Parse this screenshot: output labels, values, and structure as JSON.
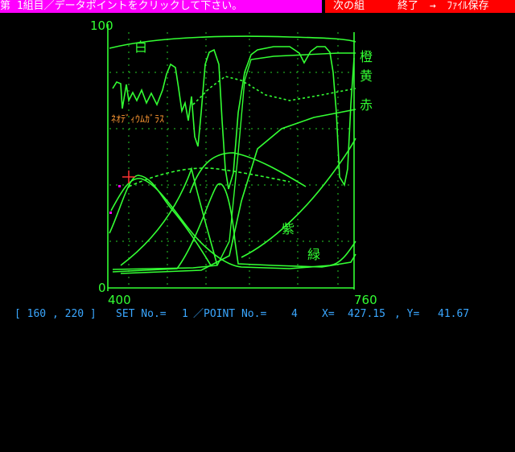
{
  "top_bar": {
    "instruction": "第 1組目／データポイントをクリックして下さい。",
    "next_set": "次の組",
    "end": "終了",
    "arrow": "→",
    "save_file": "ﾌｧｲﾙ保存"
  },
  "plot": {
    "y_top_label": "100",
    "y_bottom_label": "0",
    "x_left_label": "400",
    "x_right_label": "760",
    "labels": {
      "white": "白",
      "orange": "橙",
      "yellow": "黄",
      "red": "赤",
      "purple": "紫",
      "green": "緑",
      "neodymium": "ﾈｵﾃﾞｨｳﾑｶﾞﾗｽ"
    },
    "colors": {
      "curve": "#33ff33",
      "label": "#33ff33",
      "neodymium_label": "#ff9933",
      "marker": "#ff3333",
      "instruction_bg": "#ff00ff",
      "menu_bg": "#ff0000"
    }
  },
  "status": {
    "cursor": "[ 160 , 220 ]",
    "set_no_label": "SET No.=",
    "set_no": "1",
    "point_no_label": "／POINT No.=",
    "point_no": "4",
    "x_label": "X=",
    "x_value": "427.15",
    "y_label": ", Y=",
    "y_value": "41.67"
  }
}
